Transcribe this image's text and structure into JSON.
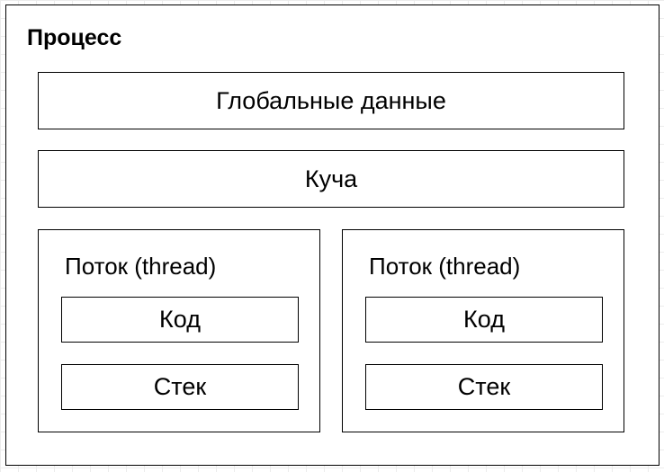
{
  "process": {
    "title": "Процесс",
    "global_data": "Глобальные данные",
    "heap": "Куча",
    "threads": [
      {
        "title": "Поток (thread)",
        "code": "Код",
        "stack": "Стек"
      },
      {
        "title": "Поток (thread)",
        "code": "Код",
        "stack": "Стек"
      }
    ]
  },
  "colors": {
    "border": "#000000",
    "background": "#ffffff",
    "grid": "#ececec"
  }
}
